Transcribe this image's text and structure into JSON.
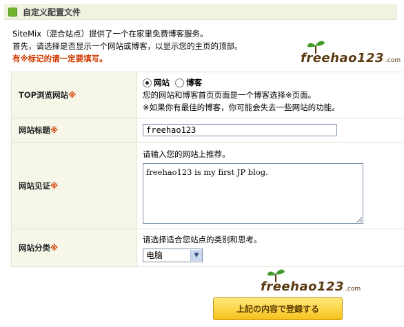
{
  "header": {
    "title": "自定义配置文件",
    "icon": "green-square-icon"
  },
  "intro": {
    "line1": "SiteMix（混合站点）提供了一个在家里免费博客服务。",
    "line2": "首先，请选择是否显示一个网站或博客，以显示您的主页的顶部。",
    "required_note": "有※标记的请一定要填写。"
  },
  "logo_top": {
    "text": "freehao123",
    "domain": ".com"
  },
  "form": {
    "top_browse": {
      "label": "TOP浏览网站",
      "mark": "※",
      "options": [
        "网站",
        "博客"
      ],
      "selected": "网站",
      "help1": "您的网站和博客首页页面是一个博客选择※页面。",
      "help2": "※如果你有最佳的博客，你可能会失去一些网站的功能。"
    },
    "site_title": {
      "label": "网站标题",
      "mark": "※",
      "value": "freehao123"
    },
    "site_desc": {
      "label": "网站见证",
      "mark": "※",
      "hint": "请输入您的网站上推荐。",
      "value": "freehao123 is my first JP blog."
    },
    "site_category": {
      "label": "网站分类",
      "mark": "※",
      "hint": "请选择适合您站点的类别和思考。",
      "value": "电脑"
    }
  },
  "logo_bottom": {
    "text": "freehao123",
    "domain": ".com"
  },
  "submit": {
    "label": "上記の内容で登録する"
  },
  "colors": {
    "accent_red": "#d23a00",
    "label_bg": "#f6f7e9",
    "button_yellow": "#f5c21d"
  }
}
